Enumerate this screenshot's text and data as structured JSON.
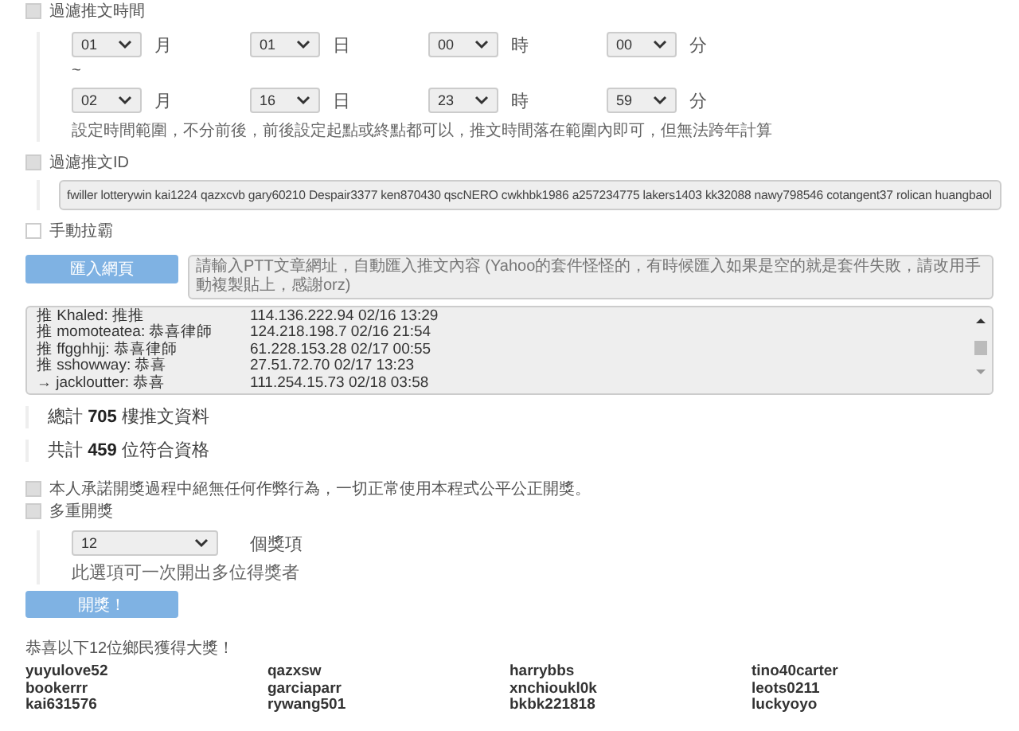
{
  "time_filter": {
    "label": "過濾推文時間",
    "checked": true,
    "rows": [
      [
        {
          "value": "01",
          "unit": "月"
        },
        {
          "value": "01",
          "unit": "日"
        },
        {
          "value": "00",
          "unit": "時"
        },
        {
          "value": "00",
          "unit": "分"
        }
      ],
      [
        {
          "value": "02",
          "unit": "月"
        },
        {
          "value": "16",
          "unit": "日"
        },
        {
          "value": "23",
          "unit": "時"
        },
        {
          "value": "59",
          "unit": "分"
        }
      ]
    ],
    "separator": "~",
    "note": "設定時間範圍，不分前後，前後設定起點或終點都可以，推文時間落在範圍內即可，但無法跨年計算"
  },
  "id_filter": {
    "label": "過濾推文ID",
    "checked": true,
    "value": "fwiller lotterywin kai1224 qazxcvb gary60210 Despair3377 ken870430 qscNERO cwkhbk1986 a257234775 lakers1403 kk32088 nawy798546 cotangent37 rolican huangbaol"
  },
  "manual": {
    "label": "手動拉霸",
    "checked": false
  },
  "import": {
    "button": "匯入網頁",
    "placeholder": "請輸入PTT文章網址，自動匯入推文內容 (Yahoo的套件怪怪的，有時候匯入如果是空的就是套件失敗，請改用手動複製貼上，感謝orz)"
  },
  "comments": [
    {
      "text": "推 Khaled: 推推",
      "meta": "114.136.222.94 02/16 13:29"
    },
    {
      "text": "推 momoteatea: 恭喜律師",
      "meta": "124.218.198.7 02/16 21:54"
    },
    {
      "text": "推 ffgghhjj: 恭喜律師",
      "meta": "61.228.153.28 02/17 00:55"
    },
    {
      "text": "推 sshowway: 恭喜",
      "meta": "27.51.72.70 02/17 13:23"
    },
    {
      "text": "→ jackloutter: 恭喜",
      "meta": "111.254.15.73 02/18 03:58"
    }
  ],
  "stats": [
    "總計 **705** 樓推文資料",
    "共計 **459** 位符合資格"
  ],
  "pledge": {
    "label": "本人承諾開獎過程中絕無任何作弊行為，一切正常使用本程式公平公正開獎。",
    "checked": true
  },
  "multi": {
    "label": "多重開獎",
    "checked": true,
    "count": "12",
    "unit": "個獎項",
    "note": "此選項可一次開出多位得獎者"
  },
  "draw_button": "開獎！",
  "congrats": "恭喜以下12位鄉民獲得大獎！",
  "winners": [
    "yuyulove52",
    "qazxsw",
    "harrybbs",
    "tino40carter",
    "bookerrr",
    "garciaparr",
    "xnchioukl0k",
    "leots0211",
    "kai631576",
    "rywang501",
    "bkbk221818",
    "luckyoyo"
  ]
}
